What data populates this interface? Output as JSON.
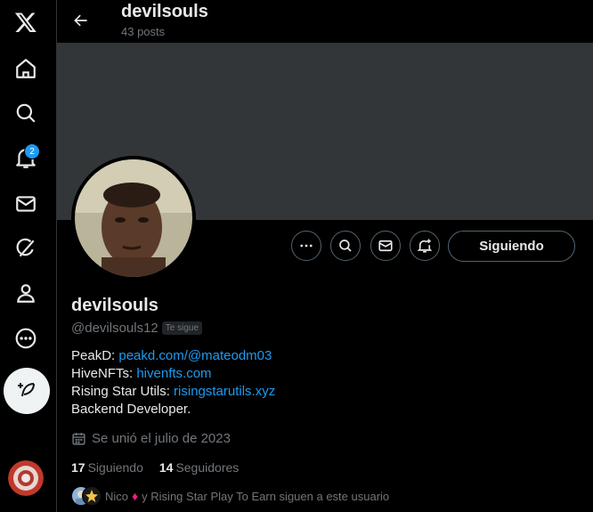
{
  "sidebar": {
    "notification_count": "2",
    "items": [
      {
        "name": "x-logo-icon"
      },
      {
        "name": "home-icon"
      },
      {
        "name": "explore-icon"
      },
      {
        "name": "notifications-icon"
      },
      {
        "name": "messages-icon"
      },
      {
        "name": "grok-icon"
      },
      {
        "name": "profile-icon"
      },
      {
        "name": "more-icon"
      }
    ]
  },
  "header": {
    "name": "devilsouls",
    "posts": "43 posts"
  },
  "profile": {
    "display_name": "devilsouls",
    "handle": "@devilsouls12",
    "follows_you": "Te sigue",
    "bio": {
      "line1_label": "PeakD: ",
      "line1_link": "peakd.com/@mateodm03",
      "line2_label": "HiveNFTs: ",
      "line2_link": "hivenfts.com",
      "line3_label": "Rising Star Utils: ",
      "line3_link": "risingstarutils.xyz",
      "line4": "Backend Developer."
    },
    "joined": "Se unió el julio de 2023",
    "following_count": "17",
    "following_label": "Siguiendo",
    "followers_count": "14",
    "followers_label": "Seguidores",
    "followed_by_name1": "Nico",
    "followed_by_rest": "y Rising Star Play To Earn siguen a este usuario"
  },
  "actions": {
    "follow_label": "Siguiendo"
  },
  "colors": {
    "accent": "#1d9bf0",
    "background": "#000000",
    "banner": "#333639"
  }
}
